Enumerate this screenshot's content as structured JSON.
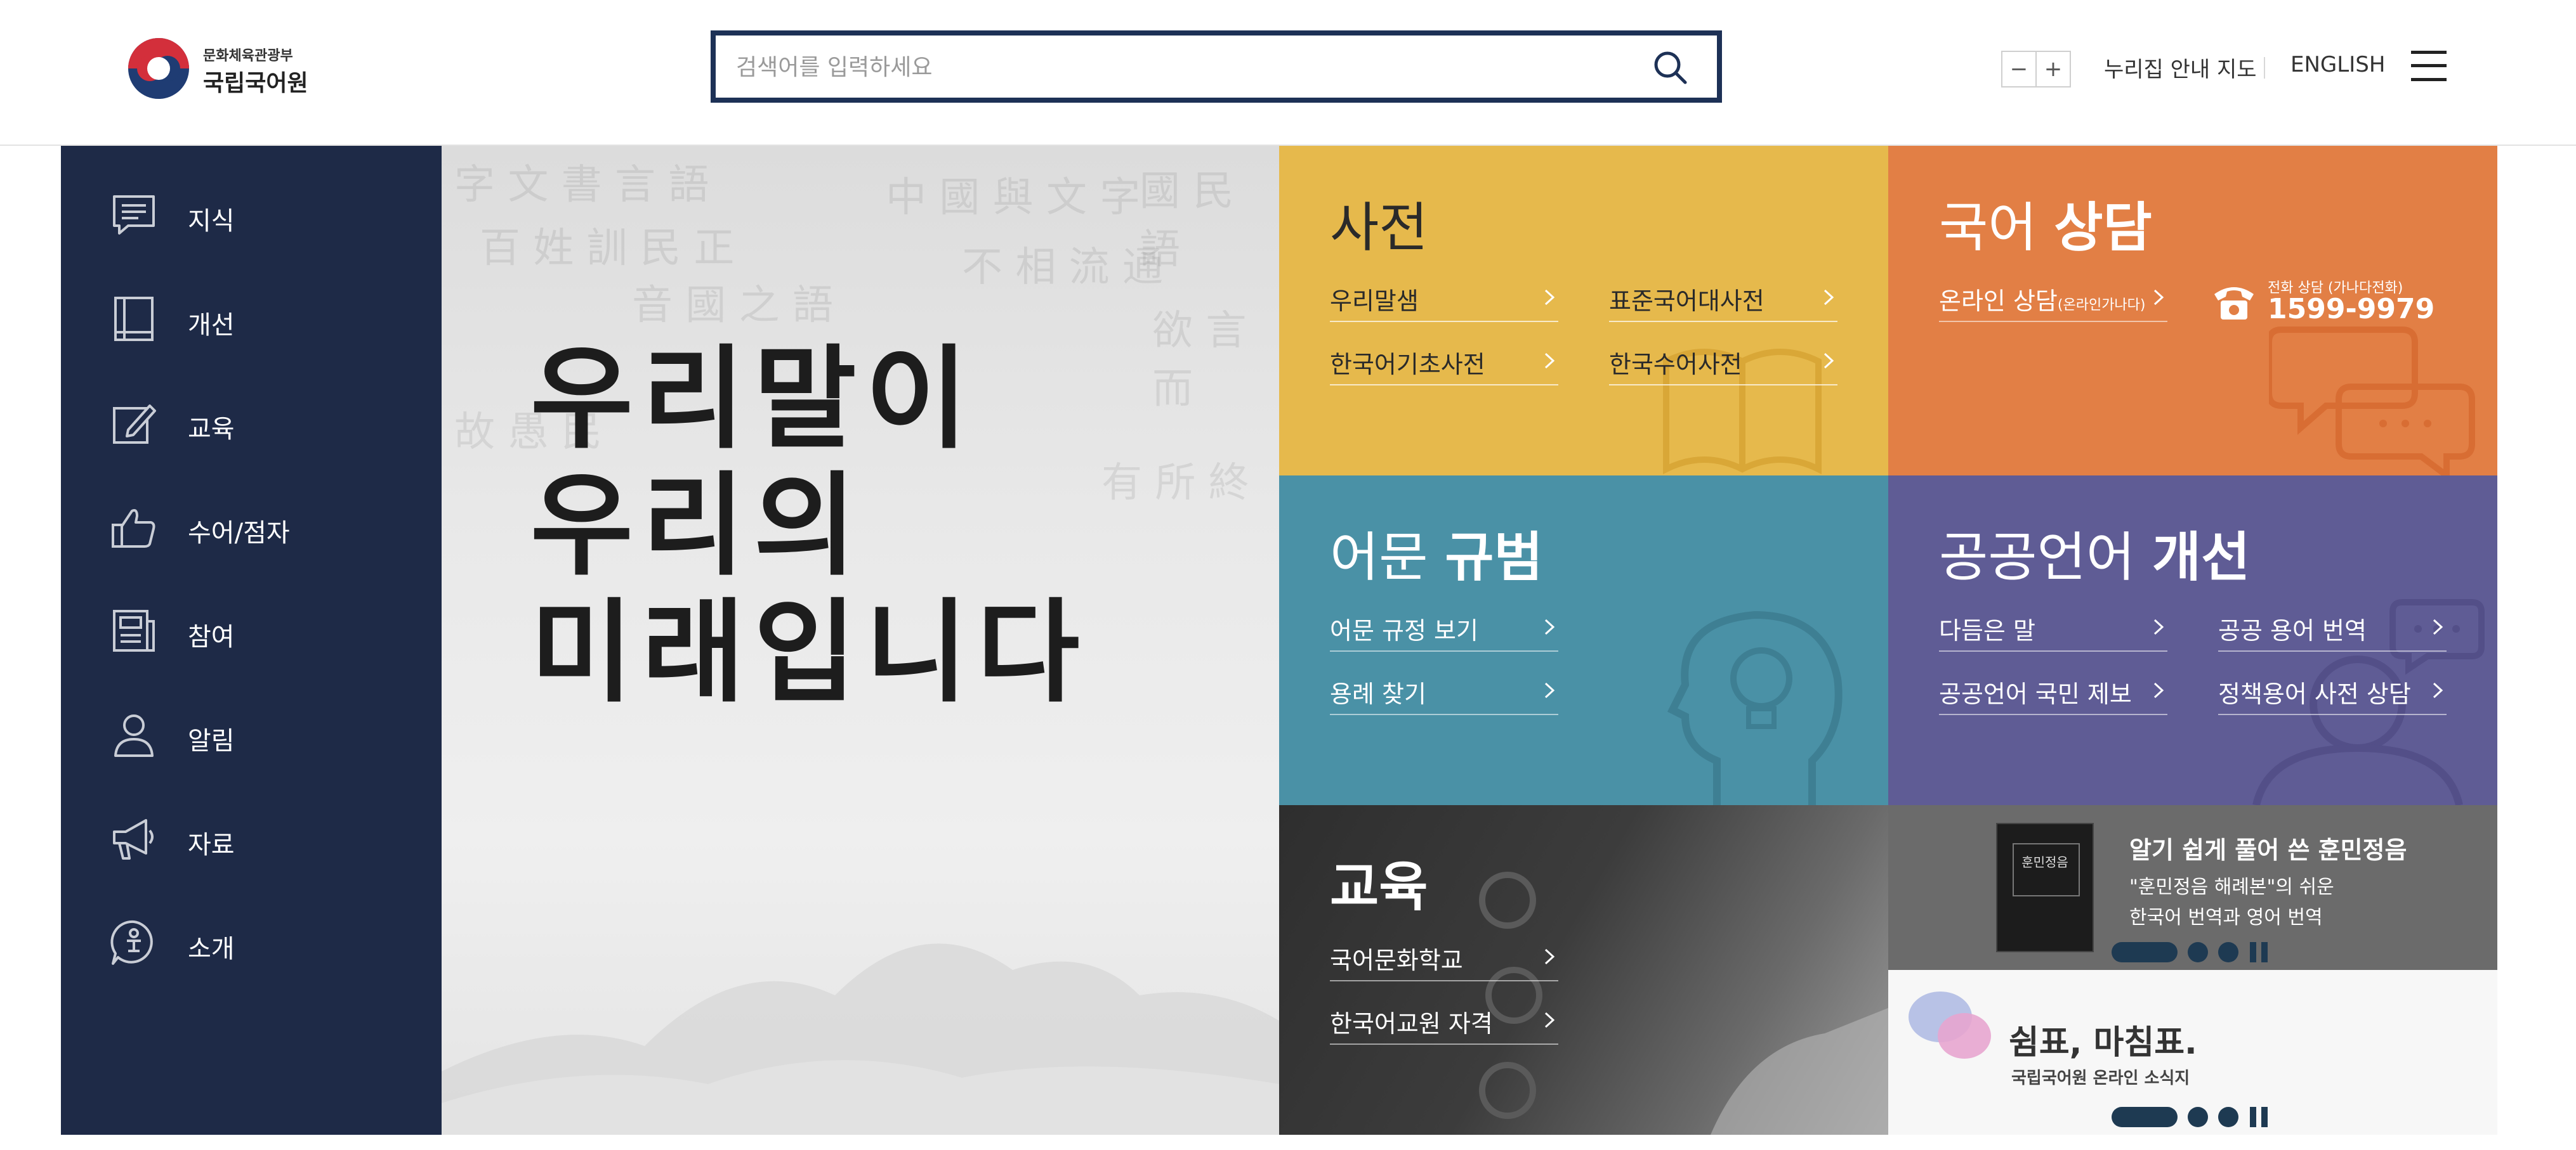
{
  "header": {
    "logo_small": "문화체육관광부",
    "logo_big": "국립국어원",
    "search_placeholder": "검색어를 입력하세요",
    "zoom_out": "−",
    "zoom_in": "+",
    "sitemap": "누리집 안내 지도",
    "english": "ENGLISH"
  },
  "sidebar": {
    "items": [
      {
        "label": "지식",
        "icon": "chat-bubble-icon"
      },
      {
        "label": "개선",
        "icon": "book-icon"
      },
      {
        "label": "교육",
        "icon": "pencil-icon"
      },
      {
        "label": "수어/점자",
        "icon": "thumb-icon"
      },
      {
        "label": "참여",
        "icon": "document-icon"
      },
      {
        "label": "알림",
        "icon": "person-icon"
      },
      {
        "label": "자료",
        "icon": "megaphone-icon"
      },
      {
        "label": "소개",
        "icon": "intro-icon"
      }
    ]
  },
  "hero": {
    "lines": [
      "우리말이",
      "우리의",
      "미래입니다"
    ]
  },
  "tiles": {
    "dictionary": {
      "title": "사전",
      "links": [
        "우리말샘",
        "표준국어대사전",
        "한국어기초사전",
        "한국수어사전"
      ]
    },
    "consult": {
      "title_light": "국어 ",
      "title_bold": "상담",
      "link": "온라인 상담",
      "link_small": "(온라인가나다)",
      "phone_label": "전화 상담 (가나다전화)",
      "phone_number": "1599-9979"
    },
    "norms": {
      "title_light": "어문 ",
      "title_bold": "규범",
      "links": [
        "어문 규정 보기",
        "용례 찾기"
      ]
    },
    "public_language": {
      "title_light": "공공언어 ",
      "title_bold": "개선",
      "links": [
        "다듬은 말",
        "공공 용어 번역",
        "공공언어 국민 제보",
        "정책용어 사전 상담"
      ]
    },
    "education": {
      "title": "교육",
      "links": [
        "국어문화학교",
        "한국어교원 자격"
      ]
    },
    "book": {
      "cover_text": "훈민정음",
      "title": "알기 쉽게 풀어 쓴 훈민정음",
      "desc1": "\"훈민정음 해례본\"의 쉬운",
      "desc2": "한국어 번역과 영어 번역"
    },
    "newsletter": {
      "title": "쉼표, 마침표.",
      "subtitle": "국립국어원 온라인 소식지"
    }
  },
  "colors": {
    "navy": "#1e2a47",
    "yellow": "#e6b94c",
    "orange": "#e27f45",
    "teal": "#4a91a6",
    "purple": "#5f5c95",
    "slider_accent": "#1e3a52"
  }
}
